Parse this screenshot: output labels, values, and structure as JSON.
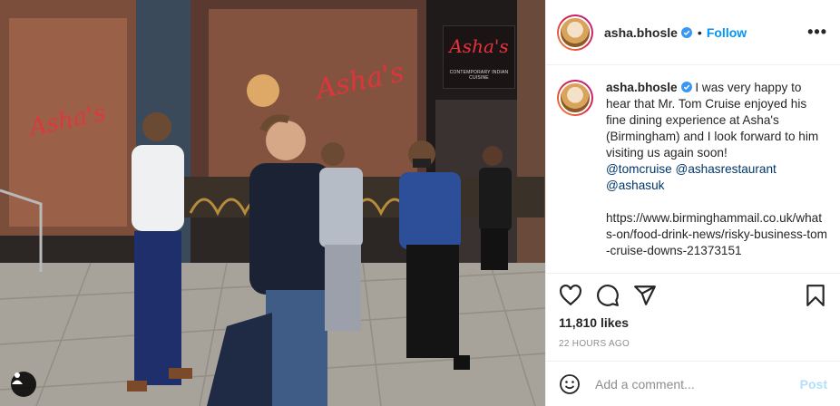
{
  "photo": {
    "description_icon": "user-tag-icon",
    "sign_main": "Asha's",
    "sign_sub": "CONTEMPORARY INDIAN CUISINE",
    "window_logo": "Asha's"
  },
  "post": {
    "username": "asha.bhosle",
    "follow_label": "Follow",
    "dot": "•",
    "more_label": "•••",
    "caption": {
      "username": "asha.bhosle",
      "text": " I was very happy to hear that Mr. Tom Cruise enjoyed his fine dining experience at Asha's (Birmingham) and I look forward to him visiting us again soon!",
      "mentions": [
        "@tomcruise",
        "@ashasrestaurant",
        "@ashasuk"
      ],
      "link": "https://www.birminghammail.co.uk/whats-on/food-drink-news/risky-business-tom-cruise-downs-21373151"
    },
    "likes": "11,810 likes",
    "timestamp": "22 HOURS AGO",
    "comment": {
      "placeholder": "Add a comment...",
      "post_label": "Post"
    }
  },
  "colors": {
    "accent": "#0095f6",
    "post_disabled": "#b2dffc",
    "mention": "#00376b",
    "muted": "#8e8e8e",
    "sign_red": "#e8323c"
  }
}
